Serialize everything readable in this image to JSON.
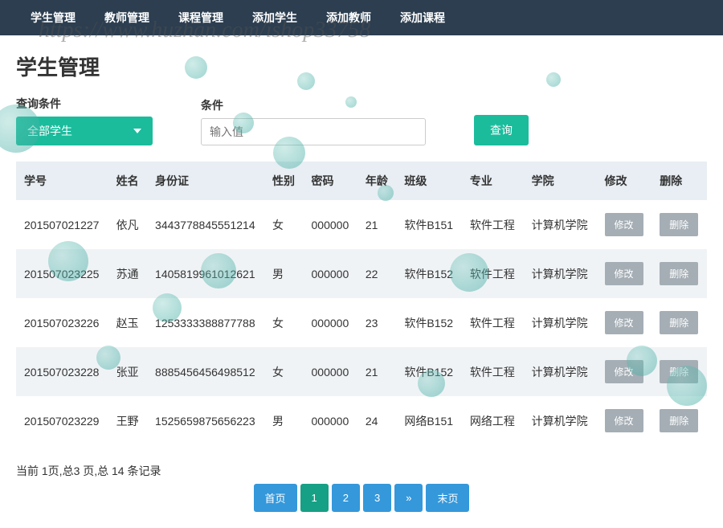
{
  "nav": {
    "items": [
      "学生管理",
      "教师管理",
      "课程管理",
      "添加学生",
      "添加教师",
      "添加课程"
    ]
  },
  "watermark": "https://www.huzhan.com/ishop33758",
  "page": {
    "title": "学生管理"
  },
  "filter": {
    "label1": "查询条件",
    "dropdown_value": "全部学生",
    "label2": "条件",
    "input_placeholder": "输入值",
    "query_btn": "查询"
  },
  "table": {
    "headers": [
      "学号",
      "姓名",
      "身份证",
      "性别",
      "密码",
      "年龄",
      "班级",
      "专业",
      "学院",
      "修改",
      "删除"
    ],
    "edit_label": "修改",
    "delete_label": "删除",
    "rows": [
      {
        "id": "201507021227",
        "name": "依凡",
        "idcard": "3443778845551214",
        "gender": "女",
        "pwd": "000000",
        "age": "21",
        "class": "软件B151",
        "major": "软件工程",
        "college": "计算机学院"
      },
      {
        "id": "201507023225",
        "name": "苏通",
        "idcard": "1405819961012621",
        "gender": "男",
        "pwd": "000000",
        "age": "22",
        "class": "软件B152",
        "major": "软件工程",
        "college": "计算机学院"
      },
      {
        "id": "201507023226",
        "name": "赵玉",
        "idcard": "1253333388877788",
        "gender": "女",
        "pwd": "000000",
        "age": "23",
        "class": "软件B152",
        "major": "软件工程",
        "college": "计算机学院"
      },
      {
        "id": "201507023228",
        "name": "张亚",
        "idcard": "8885456456498512",
        "gender": "女",
        "pwd": "000000",
        "age": "21",
        "class": "软件B152",
        "major": "软件工程",
        "college": "计算机学院"
      },
      {
        "id": "201507023229",
        "name": "王野",
        "idcard": "1525659875656223",
        "gender": "男",
        "pwd": "000000",
        "age": "24",
        "class": "网络B151",
        "major": "网络工程",
        "college": "计算机学院"
      }
    ]
  },
  "pagination": {
    "info": "当前 1页,总3 页,总 14 条记录",
    "first": "首页",
    "pages": [
      "1",
      "2",
      "3"
    ],
    "next": "»",
    "last": "末页",
    "active": 0
  }
}
